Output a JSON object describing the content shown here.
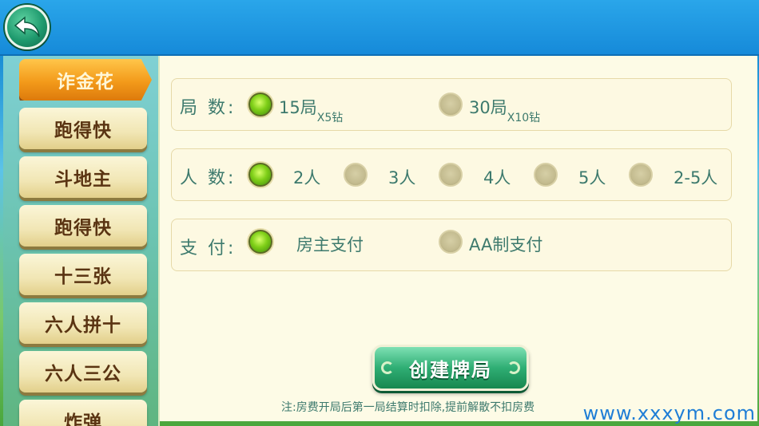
{
  "nav": {
    "back_label": "back"
  },
  "sidebar": {
    "items": [
      {
        "label": "诈金花",
        "active": true
      },
      {
        "label": "跑得快",
        "active": false
      },
      {
        "label": "斗地主",
        "active": false
      },
      {
        "label": "跑得快",
        "active": false
      },
      {
        "label": "十三张",
        "active": false
      },
      {
        "label": "六人拼十",
        "active": false
      },
      {
        "label": "六人三公",
        "active": false
      },
      {
        "label": "炸弹",
        "active": false
      }
    ]
  },
  "settings": {
    "rounds": {
      "label": "局 数:",
      "options": [
        {
          "label": "15局",
          "cost": "X5钻",
          "selected": true
        },
        {
          "label": "30局",
          "cost": "X10钻",
          "selected": false
        }
      ]
    },
    "players": {
      "label": "人 数:",
      "options": [
        {
          "label": "2人",
          "selected": true
        },
        {
          "label": "3人",
          "selected": false
        },
        {
          "label": "4人",
          "selected": false
        },
        {
          "label": "5人",
          "selected": false
        },
        {
          "label": "2-5人",
          "selected": false
        }
      ]
    },
    "payment": {
      "label": "支 付:",
      "options": [
        {
          "label": "房主支付",
          "selected": true
        },
        {
          "label": "AA制支付",
          "selected": false
        }
      ]
    }
  },
  "actions": {
    "create_label": "创建牌局"
  },
  "note": "注:房费开局后第一局结算时扣除,提前解散不扣房费",
  "watermark": "www.xxxym.com",
  "colors": {
    "accent_orange": "#f39a1a",
    "text_teal": "#3d7a6d",
    "radio_on_green": "#7fcf18",
    "button_green": "#2fae74"
  }
}
